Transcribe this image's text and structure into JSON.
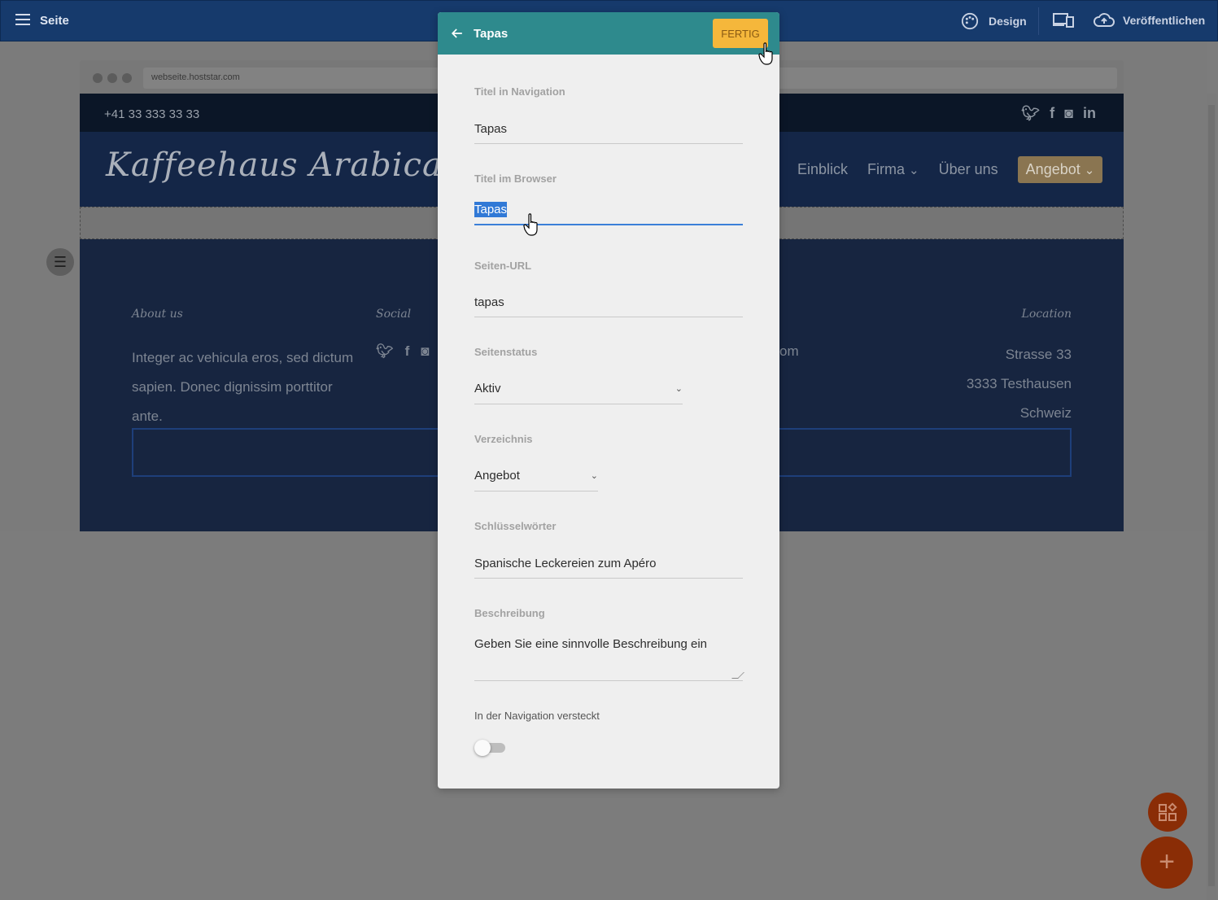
{
  "topbar": {
    "page_label": "Seite",
    "design_label": "Design",
    "publish_label": "Veröffentlichen"
  },
  "browser": {
    "url": "webseite.hoststar.com"
  },
  "site": {
    "phone": "+41 33 333 33 33",
    "logo": "Kaffeehaus Arabica",
    "nav": [
      "Einblick",
      "Firma",
      "Über uns",
      "Angebot"
    ],
    "footer": {
      "about_head": "About us",
      "social_head": "Social",
      "location_head": "Location",
      "about_text": "Integer ac vehicula eros, sed dictum sapien. Donec dignissim porttitor ante.",
      "mail_fragment": "om",
      "location": [
        "Strasse 33",
        "3333 Testhausen",
        "Schweiz"
      ]
    }
  },
  "modal": {
    "title": "Tapas",
    "done_label": "FERTIG",
    "fields": {
      "nav_title_label": "Titel in Navigation",
      "nav_title_value": "Tapas",
      "browser_title_label": "Titel im Browser",
      "browser_title_value": "Tapas",
      "url_label": "Seiten-URL",
      "url_value": "tapas",
      "status_label": "Seitenstatus",
      "status_value": "Aktiv",
      "directory_label": "Verzeichnis",
      "directory_value": "Angebot",
      "keywords_label": "Schlüsselwörter",
      "keywords_value": "Spanische Leckereien zum Apéro",
      "description_label": "Beschreibung",
      "description_value": "Geben Sie eine sinnvolle Beschreibung ein",
      "hidden_label": "In der Navigation versteckt"
    }
  },
  "colors": {
    "topbar": "#163a6c",
    "modal_header": "#2e8a8d",
    "done_button": "#f5b73b",
    "focus_line": "#3b7fd8",
    "fab": "#8a2d06"
  },
  "icons": {
    "menu": "hamburger-icon",
    "design": "palette-icon",
    "devices": "devices-icon",
    "publish": "cloud-upload-icon",
    "back": "arrow-left-icon",
    "settings": "sliders-icon",
    "add": "plus-icon",
    "widgets": "widgets-icon"
  }
}
